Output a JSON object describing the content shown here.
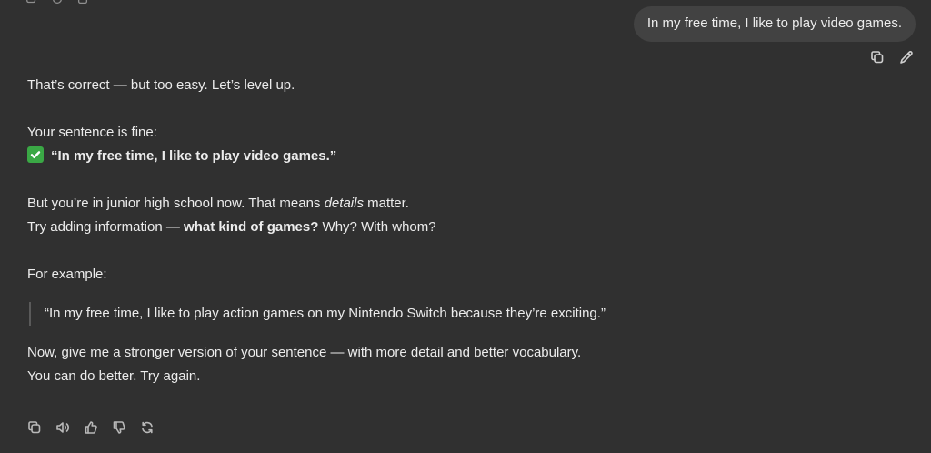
{
  "user_message": {
    "text": "In my free time, I like to play video games."
  },
  "assistant_message": {
    "line1": "That’s correct — but too easy. Let’s level up.",
    "line2": "Your sentence is fine:",
    "line3_quote": "“In my free time, I like to play video games.”",
    "line4_part1": "But you’re in junior high school now. That means ",
    "line4_em": "details",
    "line4_part2": " matter.",
    "line5_part1": "Try adding information — ",
    "line5_bold": "what kind of games?",
    "line5_part2": " Why? With whom?",
    "line6": "For example:",
    "blockquote": "“In my free time, I like to play action games on my Nintendo Switch because they’re exciting.”",
    "line7": "Now, give me a stronger version of your sentence — with more detail and better vocabulary.",
    "line8": "You can do better. Try again."
  },
  "icons": {
    "user_actions": [
      "copy-icon",
      "edit-icon"
    ],
    "assistant_actions": [
      "copy-icon",
      "read-aloud-icon",
      "thumbs-up-icon",
      "thumbs-down-icon",
      "regenerate-icon"
    ]
  },
  "colors": {
    "background": "#303030",
    "bubble": "#424242",
    "text": "#ececec",
    "check": "#3aa845"
  }
}
